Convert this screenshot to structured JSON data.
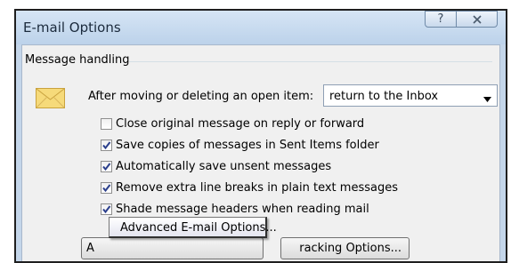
{
  "window": {
    "title": "E-mail Options",
    "help_glyph": "?",
    "close_glyph": "✕"
  },
  "group": {
    "title": "Message handling"
  },
  "after_move": {
    "label": "After moving or deleting an open item:",
    "selected": "return to the Inbox"
  },
  "checkboxes": [
    {
      "label": "Close original message on reply or forward",
      "checked": false
    },
    {
      "label": "Save copies of messages in Sent Items folder",
      "checked": true
    },
    {
      "label": "Automatically save unsent messages",
      "checked": true
    },
    {
      "label": "Remove extra line breaks in plain text messages",
      "checked": true
    },
    {
      "label": "Shade message headers when reading mail",
      "checked": true
    }
  ],
  "buttons": {
    "advanced_visible": "A",
    "tracking_visible": "racking Options..."
  },
  "tooltip": {
    "text": "Advanced E-mail Options..."
  },
  "colors": {
    "titlebar": "#c4d6ea",
    "dialog_bg": "#f0f0f0",
    "checkmark": "#2b3f8c",
    "envelope": "#f6da7a"
  }
}
